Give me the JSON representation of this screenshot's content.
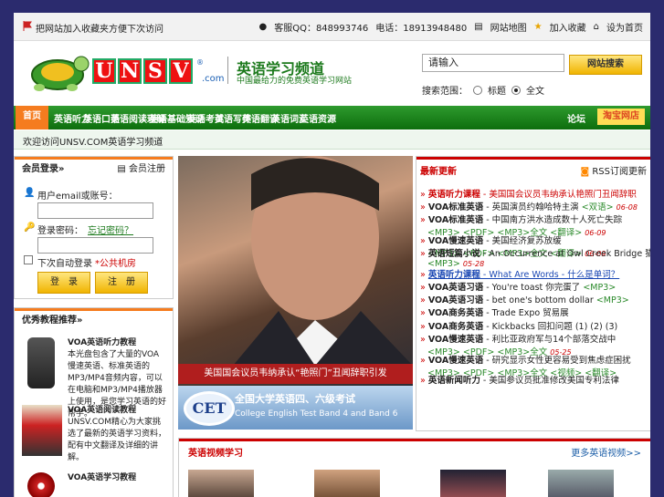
{
  "topbar": {
    "favorite_text": "把网站加入收藏夹方便下次访问",
    "contact_qq": "客服QQ：848993746",
    "contact_phone": "电话：18913948480",
    "links": [
      "网站地图",
      "加入收藏",
      "设为首页"
    ]
  },
  "header": {
    "logo_letters": [
      "U",
      "N",
      "S",
      "V"
    ],
    "logo_com": ".com",
    "logo_reg": "®",
    "title": "英语学习频道",
    "subtitle": "中国最给力的免费英语学习网站",
    "search_value": "请输入",
    "search_button": "网站搜索",
    "search_scope_label": "搜索范围：",
    "search_options": [
      "标题",
      "全文"
    ],
    "search_selected": "全文"
  },
  "nav": {
    "active": "首页",
    "items": [
      "英语听力",
      "英语口语",
      "英语阅读理解",
      "英语基础知识",
      "英语考试",
      "英语写作",
      "英语翻译",
      "英语词汇",
      "英语资源"
    ],
    "forum": "论坛",
    "taobao": "淘宝网店"
  },
  "notice": "欢迎访问UNSV.COM英语学习频道",
  "login": {
    "title": "会员登录»",
    "register": "会员注册",
    "email_label": "用户email或账号：",
    "password_label": "登录密码：",
    "forgot": "忘记密码？",
    "remember": "下次自动登录",
    "remember_note": "*公共机房",
    "login_button": "登　录",
    "register_button": "注　册"
  },
  "recommend": {
    "title": "优秀教程推荐»",
    "items": [
      {
        "name": "VOA英语听力教程",
        "text": "本光盘包含了大量的VOA慢速英语、标准英语的MP3/MP4音频内容，可以在电脑和MP3/MP4播放器上使用，是您学习英语的好帮手。"
      },
      {
        "name": "VOA英语阅读教程",
        "text": "UNSV.COM精心为大家挑选了最新的英语学习资料，配有中文翻译及详细的讲解。"
      },
      {
        "name": "VOA英语学习教程",
        "text": ""
      }
    ]
  },
  "center": {
    "photo_caption": "美国国会议员韦纳承认“艳照门”丑闻辞职引发",
    "cet_badge": "CET",
    "cet_title": "全国大学英语四、六级考试",
    "cet_subtitle": "College English Test Band 4 and Band 6"
  },
  "news": {
    "title": "最新更新",
    "rss": "RSS订阅更新",
    "items": [
      {
        "cat": "英语听力课程",
        "text": " - 美国国会议员韦纳承认艳照门丑闻辞职",
        "extra": "",
        "date": ""
      },
      {
        "cat": "VOA标准英语",
        "text": " - 英国演员约翰哈特主演",
        "extra": "<双语>",
        "date": "06-08"
      },
      {
        "cat": "VOA标准英语",
        "text": " - 中国南方洪水造成数十人死亡失踪",
        "extra": "<MP3> <PDF> <MP3>全文 <翻译>",
        "date": "06-09"
      },
      {
        "cat": "VOA慢速英语",
        "text": " - 美国经济复苏放缓",
        "extra": "<MP3> <PDF> <MP3>全文 <翻译>",
        "date": "06-09"
      },
      {
        "cat": "英语短篇小说",
        "text": " - An Occurrence at Owl Creek Bridge 猫头鹰溪桥上",
        "extra": "<MP3>",
        "date": "05-28"
      },
      {
        "cat": "英语听力课程",
        "text": " - What Are Words - 什么是单词？",
        "extra": "",
        "date": ""
      },
      {
        "cat": "VOA英语习语",
        "text": " - You're toast 你完蛋了",
        "extra": "<MP3>",
        "date": ""
      },
      {
        "cat": "VOA英语习语",
        "text": " - bet one's bottom dollar",
        "extra": "<MP3>",
        "date": ""
      },
      {
        "cat": "VOA商务英语",
        "text": " - Trade Expo 贸易展",
        "extra": "",
        "date": ""
      },
      {
        "cat": "VOA商务英语",
        "text": " - Kickbacks 回扣问题 (1) (2) (3)",
        "extra": "",
        "date": ""
      },
      {
        "cat": "VOA慢速英语",
        "text": " - 利比亚政府军与14个部落交战中",
        "extra": "<MP3> <PDF> <MP3>全文",
        "date": "05-25"
      },
      {
        "cat": "VOA慢速英语",
        "text": " - 研究显示女性更容易受到焦虑症困扰",
        "extra": "<MP3> <PDF> <MP3>全文 <视频> <翻译>",
        "date": ""
      },
      {
        "cat": "英语新闻听力",
        "text": " - 美国参议员批准修改美国专利法律",
        "extra": "",
        "date": ""
      }
    ]
  },
  "bottom": {
    "title": "英语视频学习",
    "more": "更多英语视频>>"
  },
  "colors": {
    "nav_green": "#1d7a1d",
    "accent_orange": "#f57c1f",
    "accent_red": "#c00000"
  }
}
